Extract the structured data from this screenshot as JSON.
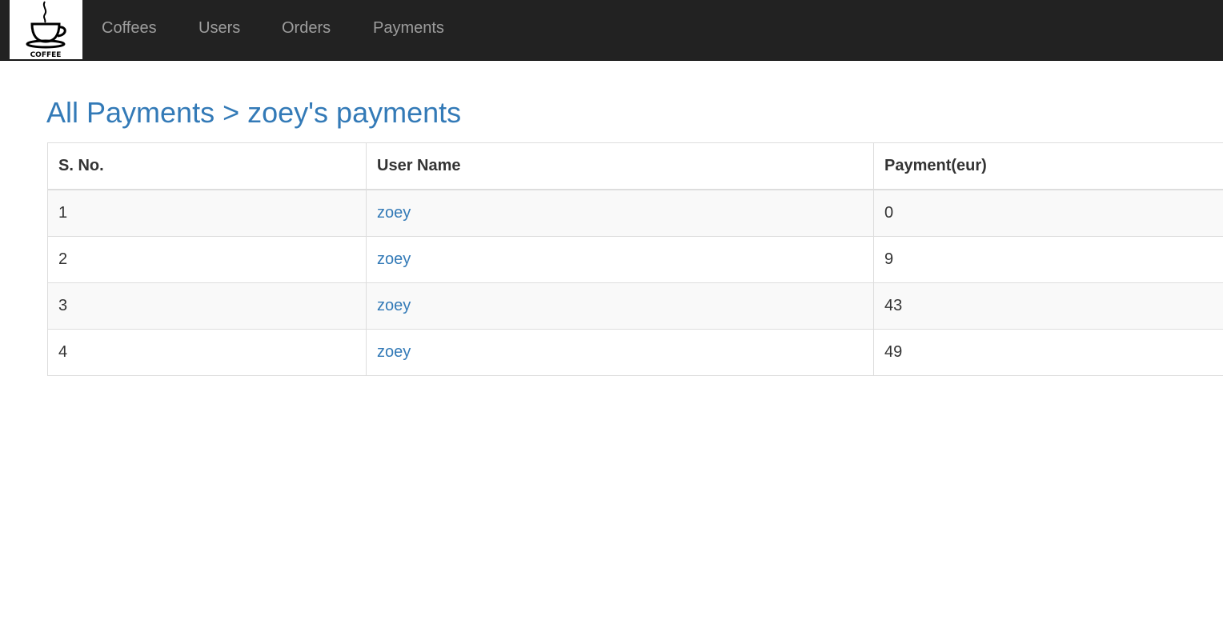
{
  "brand": {
    "icon": "coffee-cup-icon",
    "text": "COFFEE"
  },
  "nav": {
    "items": [
      {
        "label": "Coffees"
      },
      {
        "label": "Users"
      },
      {
        "label": "Orders"
      },
      {
        "label": "Payments"
      }
    ]
  },
  "page": {
    "breadcrumb_root": "All Payments",
    "separator": ">",
    "breadcrumb_current": "zoey's payments"
  },
  "table": {
    "headers": [
      "S. No.",
      "User Name",
      "Payment(eur)"
    ],
    "rows": [
      {
        "sno": "1",
        "user": "zoey",
        "payment": "0"
      },
      {
        "sno": "2",
        "user": "zoey",
        "payment": "9"
      },
      {
        "sno": "3",
        "user": "zoey",
        "payment": "43"
      },
      {
        "sno": "4",
        "user": "zoey",
        "payment": "49"
      }
    ]
  },
  "colors": {
    "navbar_bg": "#222222",
    "nav_text": "#9d9d9d",
    "link": "#337ab7",
    "row_stripe": "#f9f9f9",
    "border": "#dddddd"
  }
}
